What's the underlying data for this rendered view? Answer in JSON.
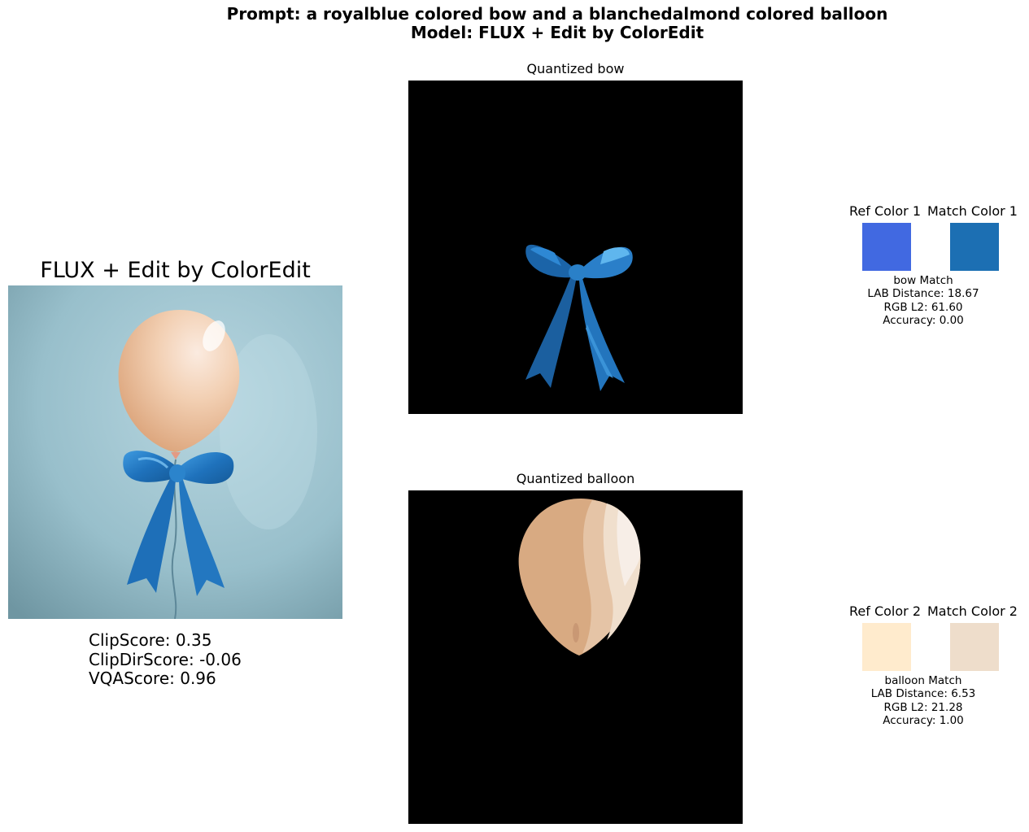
{
  "header": {
    "prompt_line": "Prompt: a royalblue colored bow and a blanchedalmond colored balloon",
    "model_line": "Model: FLUX + Edit by ColorEdit"
  },
  "main": {
    "title": "FLUX + Edit by ColorEdit",
    "scores": {
      "clip": "ClipScore: 0.35",
      "clipdir": "ClipDirScore: -0.06",
      "vqa": "VQAScore: 0.96"
    }
  },
  "panels": {
    "bow_title": "Quantized bow",
    "balloon_title": "Quantized balloon"
  },
  "matches": [
    {
      "ref_label": "Ref Color 1",
      "match_label": "Match Color 1",
      "ref_color": "#4169E1",
      "match_color": "#1C6FB3",
      "name": "bow Match",
      "lab": "LAB Distance: 18.67",
      "rgb": "RGB L2: 61.60",
      "accuracy": "Accuracy: 0.00"
    },
    {
      "ref_label": "Ref Color 2",
      "match_label": "Match Color 2",
      "ref_color": "#FFEBCD",
      "match_color": "#EEDDCB",
      "name": "balloon Match",
      "lab": "LAB Distance: 6.53",
      "rgb": "RGB L2: 21.28",
      "accuracy": "Accuracy: 1.00"
    }
  ]
}
